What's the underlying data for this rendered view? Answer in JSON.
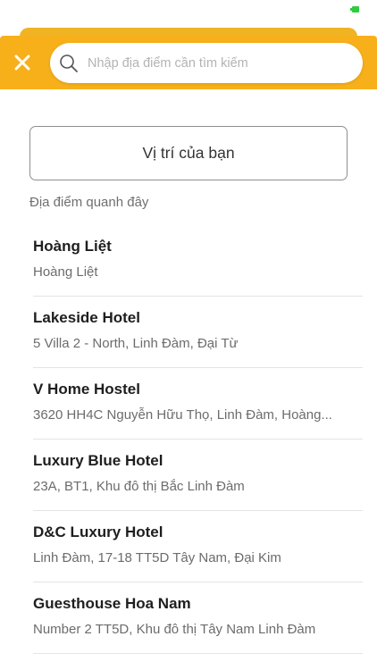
{
  "colors": {
    "header_bg": "#f7b01a",
    "header_tab": "#f0b323",
    "battery": "#2ecc40"
  },
  "header": {
    "close_icon": "close-icon",
    "search": {
      "icon": "search-icon",
      "placeholder": "Nhập địa điểm cần tìm kiếm",
      "value": ""
    }
  },
  "your_location_button": "Vị trí của bạn",
  "nearby_section_title": "Địa điểm quanh đây",
  "places": [
    {
      "name": "Hoàng Liệt",
      "address": "Hoàng Liệt"
    },
    {
      "name": "Lakeside Hotel",
      "address": "5 Villa 2 - North, Linh Đàm, Đại Từ"
    },
    {
      "name": "V Home Hostel",
      "address": "3620 HH4C Nguyễn Hữu Thọ, Linh Đàm, Hoàng..."
    },
    {
      "name": "Luxury Blue Hotel",
      "address": "23A, BT1, Khu đô thị Bắc Linh Đàm"
    },
    {
      "name": "D&C Luxury Hotel",
      "address": "Linh Đàm, 17-18 TT5D Tây Nam, Đại Kim"
    },
    {
      "name": "Guesthouse Hoa Nam",
      "address": "Number 2 TT5D, Khu đô thị Tây Nam Linh Đàm"
    }
  ]
}
